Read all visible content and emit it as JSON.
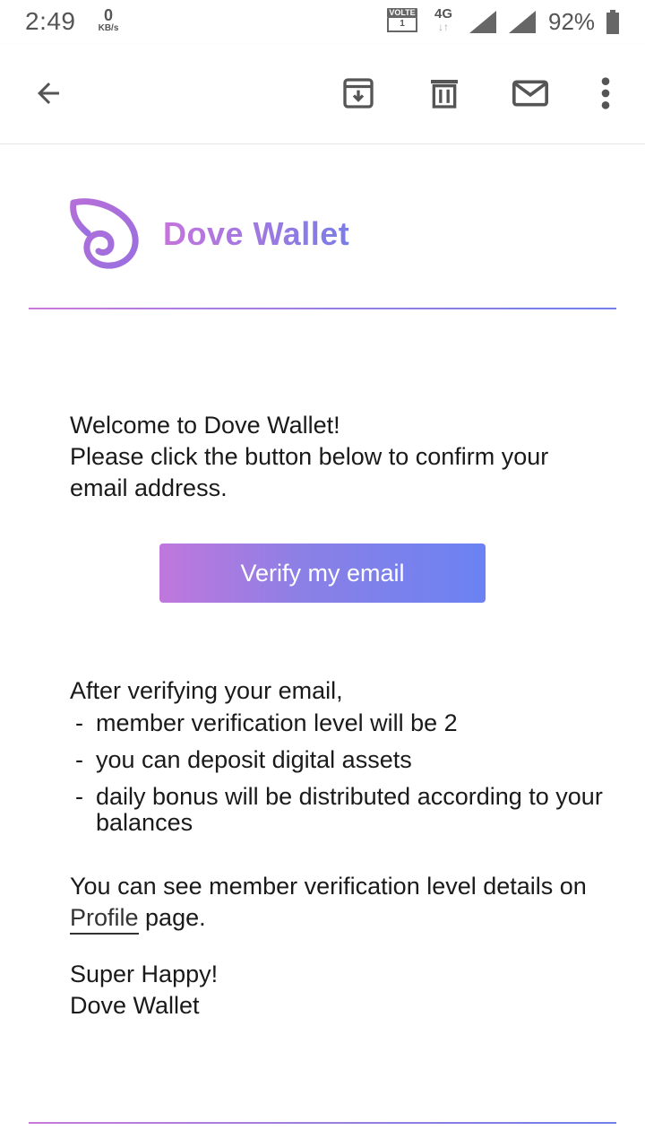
{
  "status_bar": {
    "time": "2:49",
    "net_speed_value": "0",
    "net_speed_unit": "KB/s",
    "volte_label": "VOLTE",
    "volte_sim": "1",
    "network_type": "4G",
    "network_activity": "↓↑",
    "battery_percent": "92%",
    "icons": [
      "volte-icon",
      "4g-icon",
      "signal-icon",
      "signal-icon",
      "battery-icon"
    ]
  },
  "app_bar": {
    "icons": [
      "back-arrow-icon",
      "archive-icon",
      "delete-icon",
      "mail-icon",
      "more-vert-icon"
    ]
  },
  "email": {
    "brand_name": "Dove Wallet",
    "brand_colors": {
      "start": "#c574dc",
      "end": "#7a7de6"
    },
    "intro_line1": "Welcome to Dove Wallet!",
    "intro_line2": "Please click the button below to confirm your email address.",
    "verify_button": "Verify my email",
    "after_lead": "After verifying your email,",
    "bullets": [
      "member verification level will be 2",
      "you can deposit digital assets",
      "daily bonus will be distributed according to your balances"
    ],
    "bullet_marker": "-",
    "profile_text_before": "You can see member verification level details on ",
    "profile_link": "Profile",
    "profile_text_after": " page.",
    "signoff_line1": "Super Happy!",
    "signoff_line2": "Dove Wallet"
  }
}
